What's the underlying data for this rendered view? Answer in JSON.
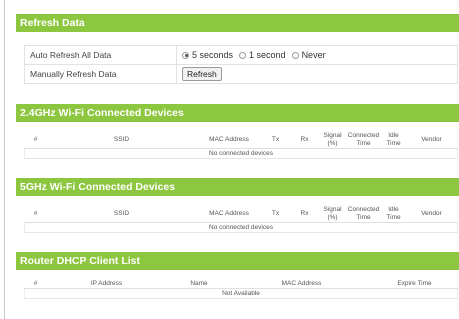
{
  "refresh": {
    "title": "Refresh Data",
    "auto_label": "Auto Refresh All Data",
    "options": [
      "5 seconds",
      "1 second",
      "Never"
    ],
    "selected_index": 0,
    "manual_label": "Manually Refresh Data",
    "refresh_button": "Refresh"
  },
  "wifi24": {
    "title": "2.4GHz Wi-Fi Connected Devices",
    "headers": [
      "#",
      "SSID",
      "MAC Address",
      "Tx",
      "Rx",
      "Signal\n(%)",
      "Connected\nTime",
      "Idle\nTime",
      "Vendor"
    ],
    "empty": "No connected devices"
  },
  "wifi5": {
    "title": "5GHz Wi-Fi Connected Devices",
    "headers": [
      "#",
      "SSID",
      "MAC Address",
      "Tx",
      "Rx",
      "Signal\n(%)",
      "Connected\nTime",
      "Idle\nTime",
      "Vendor"
    ],
    "empty": "No connected devices"
  },
  "dhcp": {
    "title": "Router DHCP Client List",
    "headers": [
      "#",
      "IP Address",
      "Name",
      "MAC Address",
      "Expire Time"
    ],
    "empty": "Not Available"
  },
  "colors": {
    "header_green": "#8dc63f"
  }
}
